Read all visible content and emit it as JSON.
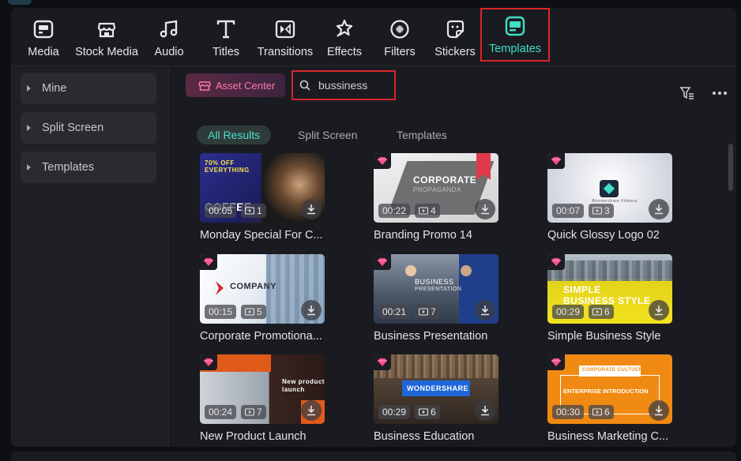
{
  "toolbar": {
    "tools": [
      {
        "label": "Media",
        "icon": "media-icon"
      },
      {
        "label": "Stock Media",
        "icon": "stock-media-icon"
      },
      {
        "label": "Audio",
        "icon": "audio-icon"
      },
      {
        "label": "Titles",
        "icon": "titles-icon"
      },
      {
        "label": "Transitions",
        "icon": "transitions-icon"
      },
      {
        "label": "Effects",
        "icon": "effects-icon"
      },
      {
        "label": "Filters",
        "icon": "filters-icon"
      },
      {
        "label": "Stickers",
        "icon": "stickers-icon"
      },
      {
        "label": "Templates",
        "icon": "templates-icon",
        "active": true
      }
    ]
  },
  "sidebar": {
    "items": [
      {
        "label": "Mine"
      },
      {
        "label": "Split Screen"
      },
      {
        "label": "Templates"
      }
    ]
  },
  "main": {
    "asset_center_label": "Asset Center",
    "search_value": "bussiness",
    "tabs": [
      {
        "label": "All Results",
        "active": true
      },
      {
        "label": "Split Screen"
      },
      {
        "label": "Templates"
      }
    ],
    "cards": [
      {
        "title": "Monday Special For C...",
        "duration": "00:05",
        "count": "1",
        "premium": false,
        "thumb_text": "COFFEE",
        "thumb_sub": "70% OFF EVERYTHING"
      },
      {
        "title": "Branding Promo 14",
        "duration": "00:22",
        "count": "4",
        "premium": true,
        "thumb_text": "CORPORATE",
        "thumb_sub": "PROPAGANDA"
      },
      {
        "title": "Quick Glossy Logo 02",
        "duration": "00:07",
        "count": "3",
        "premium": true,
        "thumb_text": "",
        "thumb_sub": "Wondershare Filmora"
      },
      {
        "title": "Corporate Promotiona...",
        "duration": "00:15",
        "count": "5",
        "premium": true,
        "thumb_text": "COMPANY",
        "thumb_sub": ""
      },
      {
        "title": "Business Presentation",
        "duration": "00:21",
        "count": "7",
        "premium": true,
        "thumb_text": "BUSINESS",
        "thumb_sub": "PRESENTATION"
      },
      {
        "title": "Simple Business Style",
        "duration": "00:29",
        "count": "6",
        "premium": true,
        "thumb_text": "SIMPLE",
        "thumb_sub": "BUSINESS STYLE"
      },
      {
        "title": "New Product Launch",
        "duration": "00:24",
        "count": "7",
        "premium": true,
        "thumb_text": "New product",
        "thumb_sub": "launch"
      },
      {
        "title": "Business Education",
        "duration": "00:29",
        "count": "6",
        "premium": true,
        "thumb_text": "WONDERSHARE",
        "thumb_sub": ""
      },
      {
        "title": "Business Marketing C...",
        "duration": "00:30",
        "count": "6",
        "premium": true,
        "thumb_text": "ENTERPRISE INTRODUCTION",
        "thumb_sub": "CORPORATE CULTUER"
      }
    ]
  },
  "colors": {
    "accent": "#3fe0c4",
    "highlight_border": "#d8262a",
    "premium_gem": "#ff4f8b",
    "asset_center_text": "#ff7aa8"
  }
}
